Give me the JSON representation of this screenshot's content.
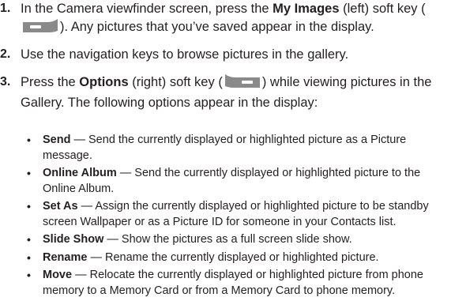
{
  "steps": [
    {
      "number": "1.",
      "pre": "In the Camera viewfinder screen, press the ",
      "bold": "My Images",
      "mid": " (left) soft key (",
      "icon": "left-softkey-icon",
      "post": "). Any pictures that you’ve saved appear in the display."
    },
    {
      "number": "2.",
      "text": "Use the navigation keys to browse pictures in the gallery."
    },
    {
      "number": "3.",
      "pre": "Press the ",
      "bold": "Options",
      "mid": " (right) soft key (",
      "icon": "right-softkey-icon",
      "post": ") while viewing pictures in the Gallery. The following options appear in the display:"
    }
  ],
  "options": [
    {
      "label": "Send",
      "desc": "Send the currently displayed or highlighted picture as a Picture message."
    },
    {
      "label": "Online Album",
      "desc": "Send the currently displayed or highlighted picture to the Online Album."
    },
    {
      "label": "Set As",
      "desc": "Assign the currently displayed or highlighted picture to be standby screen Wallpaper or as a Picture ID for someone in your Contacts list."
    },
    {
      "label": "Slide Show",
      "desc": "Show the pictures as a full screen slide show."
    },
    {
      "label": "Rename",
      "desc": "Rename the currently displayed or highlighted picture."
    },
    {
      "label": "Move",
      "desc": "Relocate the currently displayed or highlighted picture from phone memory to a Memory Card or from a Memory Card to phone memory."
    }
  ],
  "separator": " — ",
  "bullet_symbol": "•",
  "colors": {
    "text": "#231f20",
    "softkey_gray": "#8a8a8a"
  }
}
